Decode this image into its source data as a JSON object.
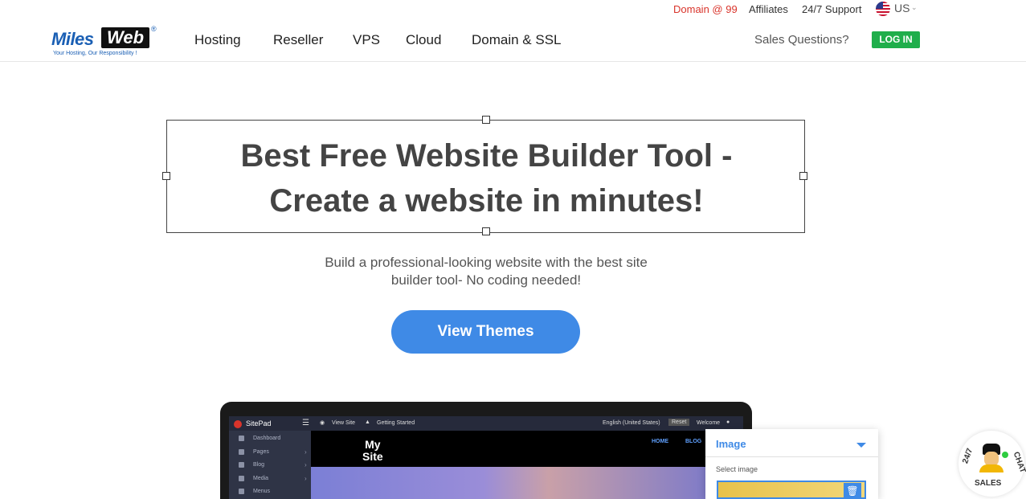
{
  "topbar": {
    "domain_offer": "Domain @ 99",
    "affiliates": "Affiliates",
    "support": "24/7 Support",
    "country": "US"
  },
  "header": {
    "logo": {
      "miles": "Miles",
      "web": "Web",
      "registered": "®",
      "tagline": "Your Hosting, Our Responsibility !"
    },
    "nav": [
      {
        "label": "Hosting"
      },
      {
        "label": "Reseller"
      },
      {
        "label": "VPS"
      },
      {
        "label": "Cloud"
      },
      {
        "label": "Domain & SSL"
      }
    ],
    "sales_questions": "Sales Questions?",
    "login": "LOG IN"
  },
  "hero": {
    "title_line1": "Best Free Website Builder Tool -",
    "title_line2": "Create a website in minutes!",
    "subtitle_line1": "Build a professional-looking website with the best site",
    "subtitle_line2": "builder tool- No coding needed!",
    "cta": "View Themes"
  },
  "mockup": {
    "app_name": "SitePad",
    "view_site": "View Site",
    "getting_started": "Getting Started",
    "language": "English (United States)",
    "reset": "Reset",
    "welcome": "Welcome",
    "sidebar": [
      {
        "label": "Dashboard"
      },
      {
        "label": "Pages"
      },
      {
        "label": "Blog"
      },
      {
        "label": "Media"
      },
      {
        "label": "Menus"
      }
    ],
    "site_title_line1": "My",
    "site_title_line2": "Site",
    "nav_home": "HOME",
    "nav_blog": "BLOG",
    "panel_title": "Image",
    "panel_select": "Select image"
  },
  "chat": {
    "label_24": "24/7",
    "label_sales": "SALES",
    "label_chat": "CHAT"
  },
  "colors": {
    "accent": "#3f8ae6",
    "login_green": "#1fae4b",
    "offer_red": "#d9342b"
  }
}
